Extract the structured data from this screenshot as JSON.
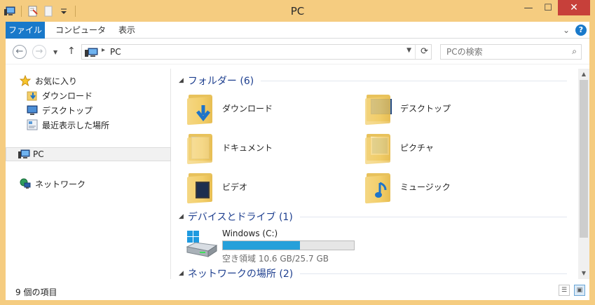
{
  "window": {
    "title": "PC",
    "controls": {
      "minimize": "—",
      "maximize": "☐",
      "close": "✕"
    }
  },
  "ribbon": {
    "tabs": [
      {
        "label": "ファイル",
        "active": true
      },
      {
        "label": "コンピューター",
        "active": false
      },
      {
        "label": "表示",
        "active": false
      }
    ],
    "expand_glyph": "⌄",
    "help_glyph": "?"
  },
  "address_bar": {
    "back_glyph": "←",
    "forward_glyph": "→",
    "up_glyph": "↑",
    "breadcrumb_separator": "▸",
    "location": "PC",
    "refresh_glyph": "⟳",
    "search_placeholder": "PCの検索",
    "search_glyph": "⌕"
  },
  "sidebar": {
    "favorites": {
      "label": "お気に入り",
      "items": [
        {
          "label": "ダウンロード",
          "icon": "download-folder-icon"
        },
        {
          "label": "デスクトップ",
          "icon": "desktop-icon"
        },
        {
          "label": "最近表示した場所",
          "icon": "recent-places-icon"
        }
      ]
    },
    "pc": {
      "label": "PC",
      "selected": true
    },
    "network": {
      "label": "ネットワーク"
    }
  },
  "content": {
    "groups": [
      {
        "title": "フォルダー (6)",
        "collapse_glyph": "◢"
      },
      {
        "title": "デバイスとドライブ (1)",
        "collapse_glyph": "◢"
      },
      {
        "title": "ネットワークの場所 (2)",
        "collapse_glyph": "◢"
      }
    ],
    "folders": [
      {
        "label": "ダウンロード",
        "icon": "downloads-folder-icon"
      },
      {
        "label": "デスクトップ",
        "icon": "desktop-folder-icon"
      },
      {
        "label": "ドキュメント",
        "icon": "documents-folder-icon"
      },
      {
        "label": "ピクチャ",
        "icon": "pictures-folder-icon"
      },
      {
        "label": "ビデオ",
        "icon": "videos-folder-icon"
      },
      {
        "label": "ミュージック",
        "icon": "music-folder-icon"
      }
    ],
    "drives": [
      {
        "name": "Windows (C:)",
        "free_text": "空き領域 10.6 GB/25.7 GB",
        "used_fraction": 0.59,
        "bar_color": "#26a0da"
      }
    ]
  },
  "status_bar": {
    "item_count": "9 個の項目"
  },
  "colors": {
    "frame": "#f5cc80",
    "file_tab": "#1979ca",
    "close_button": "#c7403a",
    "group_title": "#1e3f8f"
  }
}
